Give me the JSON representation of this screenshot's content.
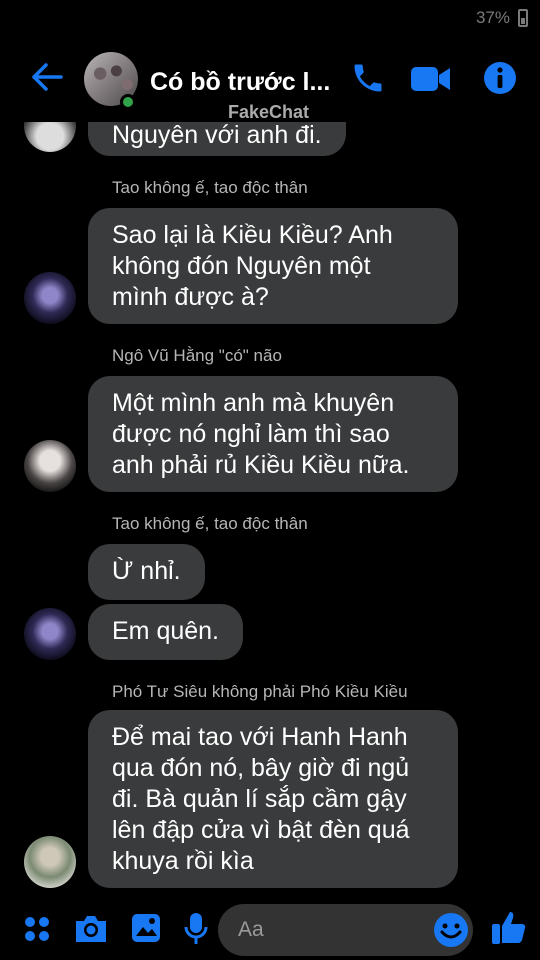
{
  "status_bar": {
    "battery": "37%"
  },
  "header": {
    "title": "Có bồ trước l...",
    "watermark": "FakeChat"
  },
  "messages": [
    {
      "type": "bubble",
      "text": "Nguyên với anh đi."
    },
    {
      "type": "sender",
      "text": "Tao không ế, tao độc thân"
    },
    {
      "type": "bubble",
      "lines": [
        "Sao lại là Kiều Kiều? Anh",
        "không đón Nguyên một",
        "mình được à?"
      ]
    },
    {
      "type": "sender",
      "text": "Ngô Vũ Hằng \"có\" não"
    },
    {
      "type": "bubble",
      "lines": [
        "Một mình anh mà khuyên",
        "được nó nghỉ làm thì sao",
        "anh phải rủ Kiều Kiều nữa."
      ]
    },
    {
      "type": "sender",
      "text": "Tao không ế, tao độc thân"
    },
    {
      "type": "bubble",
      "text": "Ừ nhỉ."
    },
    {
      "type": "bubble",
      "text": "Em quên."
    },
    {
      "type": "sender",
      "text": "Phó Tư Siêu không phải Phó Kiều Kiều"
    },
    {
      "type": "bubble",
      "lines": [
        "Để mai tao với Hanh Hanh",
        "qua đón nó, bây giờ đi ngủ",
        "đi. Bà quản lí sắp cầm gậy",
        "lên đập cửa vì bật đèn quá",
        "khuya rồi kìa"
      ]
    }
  ],
  "composer": {
    "placeholder": "Aa"
  },
  "colors": {
    "accent": "#1877f2",
    "bubble": "#3a3b3c",
    "background": "#000000",
    "online": "#31a24c"
  },
  "icons": [
    "back-arrow-icon",
    "phone-icon",
    "video-icon",
    "info-icon",
    "apps-icon",
    "camera-icon",
    "gallery-icon",
    "microphone-icon",
    "emoji-icon",
    "like-icon"
  ]
}
